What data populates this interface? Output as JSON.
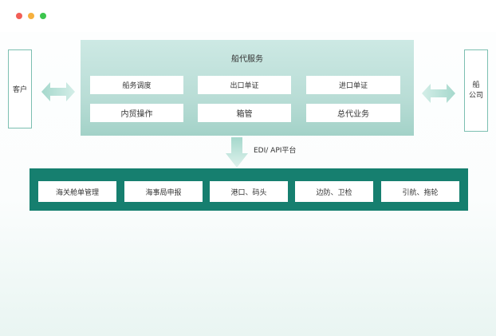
{
  "window": {
    "controls": [
      {
        "name": "close",
        "color": "#f25f57"
      },
      {
        "name": "minimize",
        "color": "#f6b03e"
      },
      {
        "name": "maximize",
        "color": "#3cc54d"
      }
    ]
  },
  "diagram": {
    "left_party": "客户",
    "right_party": [
      "船",
      "公司"
    ],
    "service_panel": {
      "title": "船代服务",
      "row1": [
        "船务调度",
        "出口单证",
        "进口单证"
      ],
      "row2": [
        "内贸操作",
        "箱管",
        "总代业务"
      ]
    },
    "platform_label": "EDI/ API平台",
    "institutions": [
      "海关舱单管理",
      "海事局申报",
      "港口、码头",
      "边防、卫检",
      "引航、拖轮"
    ]
  },
  "colors": {
    "panel_gradient_top": "#cde9e4",
    "panel_gradient_bottom": "#a3d2c8",
    "band": "#167f6f",
    "arrow": "#b8e2d9",
    "box_border": "#7cbfb1"
  }
}
